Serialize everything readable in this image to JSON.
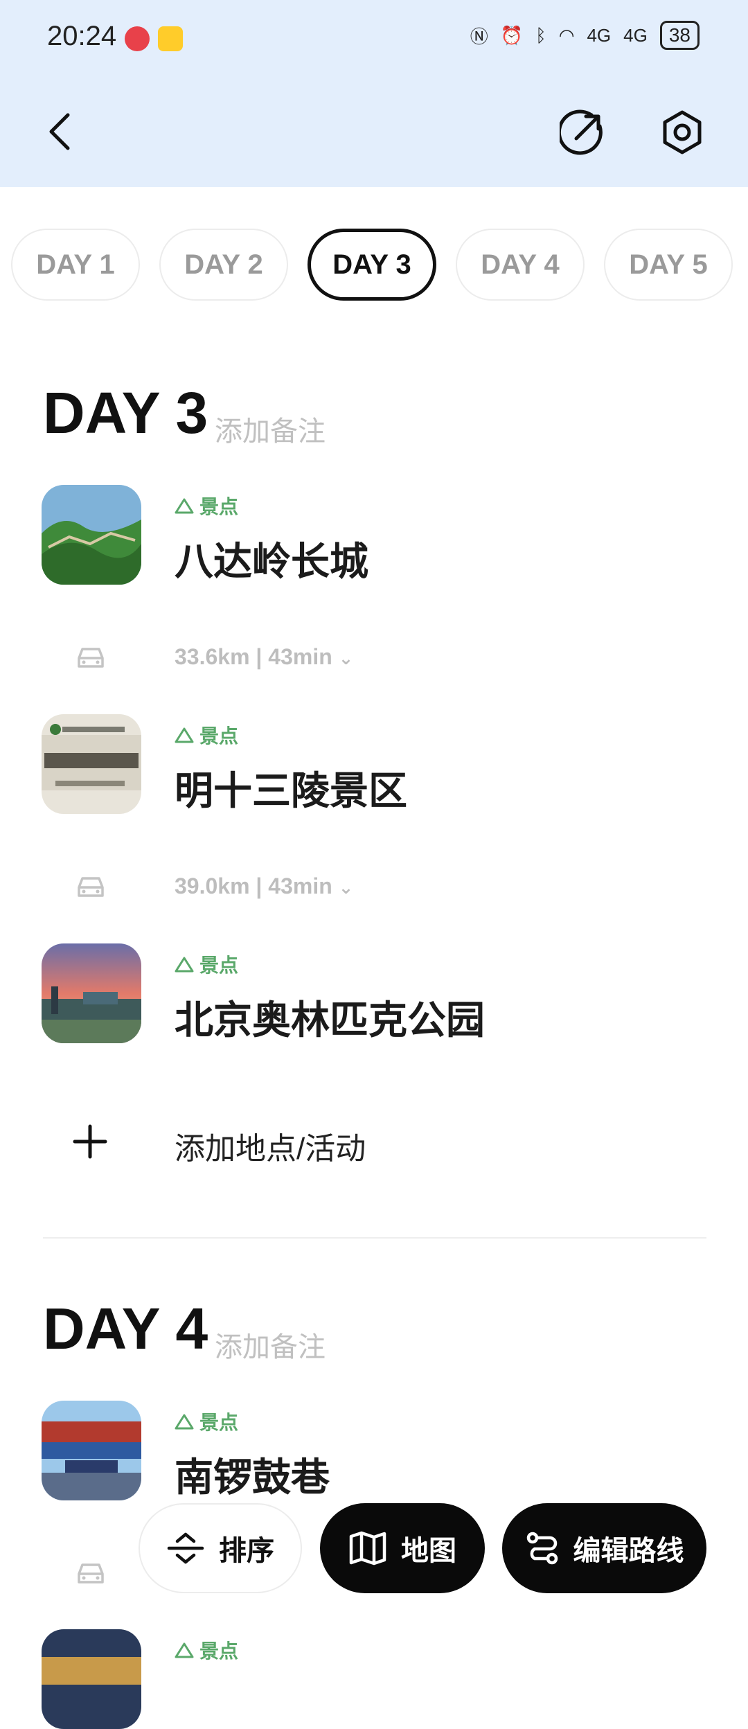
{
  "status_bar": {
    "time": "20:24",
    "network": "4G",
    "battery": "38"
  },
  "tabs": [
    "DAY 1",
    "DAY 2",
    "DAY 3",
    "DAY 4",
    "DAY 5"
  ],
  "active_tab": "DAY 3",
  "days": [
    {
      "title": "DAY 3",
      "note_placeholder": "添加备注",
      "places": [
        {
          "tag": "景点",
          "name": "八达岭长城"
        },
        {
          "tag": "景点",
          "name": "明十三陵景区"
        },
        {
          "tag": "景点",
          "name": "北京奥林匹克公园"
        }
      ],
      "routes": [
        "33.6km | 43min",
        "39.0km | 43min"
      ],
      "add_label": "添加地点/活动"
    },
    {
      "title": "DAY 4",
      "note_placeholder": "添加备注",
      "places": [
        {
          "tag": "景点",
          "name": "南锣鼓巷"
        },
        {
          "tag": "景点"
        }
      ]
    }
  ],
  "toolbar": {
    "sort_label": "排序",
    "map_label": "地图",
    "edit_route_label": "编辑路线"
  },
  "colors": {
    "header_bg": "#e3eefc",
    "tag_green": "#5aa86a",
    "fab_dark": "#0a0a0a"
  }
}
